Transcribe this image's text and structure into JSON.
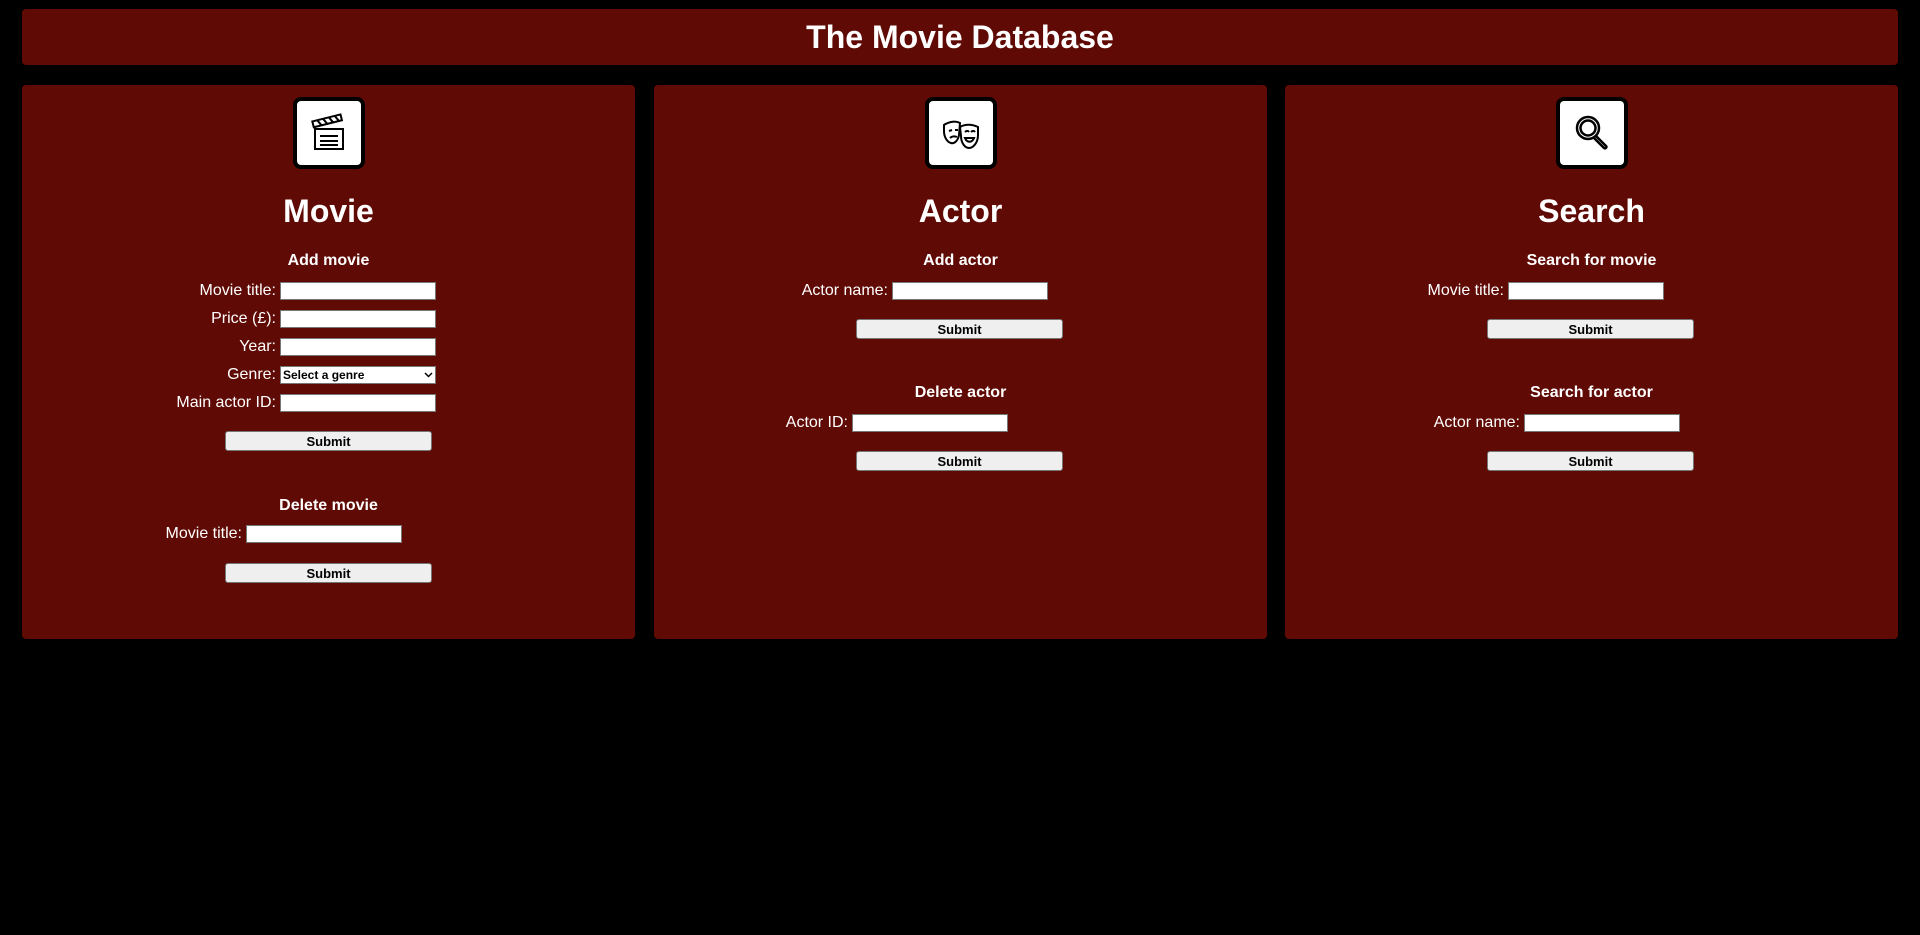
{
  "header": {
    "title": "The Movie Database"
  },
  "movie": {
    "title": "Movie",
    "icon": "clapperboard-icon",
    "add": {
      "heading": "Add movie",
      "fields": [
        {
          "label": "Movie title:",
          "value": ""
        },
        {
          "label": "Price (£):",
          "value": ""
        },
        {
          "label": "Year:",
          "value": ""
        },
        {
          "label": "Genre:",
          "select": "Select a genre"
        },
        {
          "label": "Main actor ID:",
          "value": ""
        }
      ],
      "submit": "Submit"
    },
    "delete": {
      "heading": "Delete movie",
      "field_label": "Movie title:",
      "submit": "Submit"
    }
  },
  "actor": {
    "title": "Actor",
    "icon": "theater-masks-icon",
    "add": {
      "heading": "Add actor",
      "field_label": "Actor name:",
      "submit": "Submit"
    },
    "delete": {
      "heading": "Delete actor",
      "field_label": "Actor ID:",
      "submit": "Submit"
    }
  },
  "search": {
    "title": "Search",
    "icon": "magnifier-icon",
    "movie": {
      "heading": "Search for movie",
      "field_label": "Movie title:",
      "submit": "Submit"
    },
    "actor": {
      "heading": "Search for actor",
      "field_label": "Actor name:",
      "submit": "Submit"
    }
  },
  "colors": {
    "background": "#000000",
    "panel": "#5f0a04",
    "text": "#ffffff"
  }
}
